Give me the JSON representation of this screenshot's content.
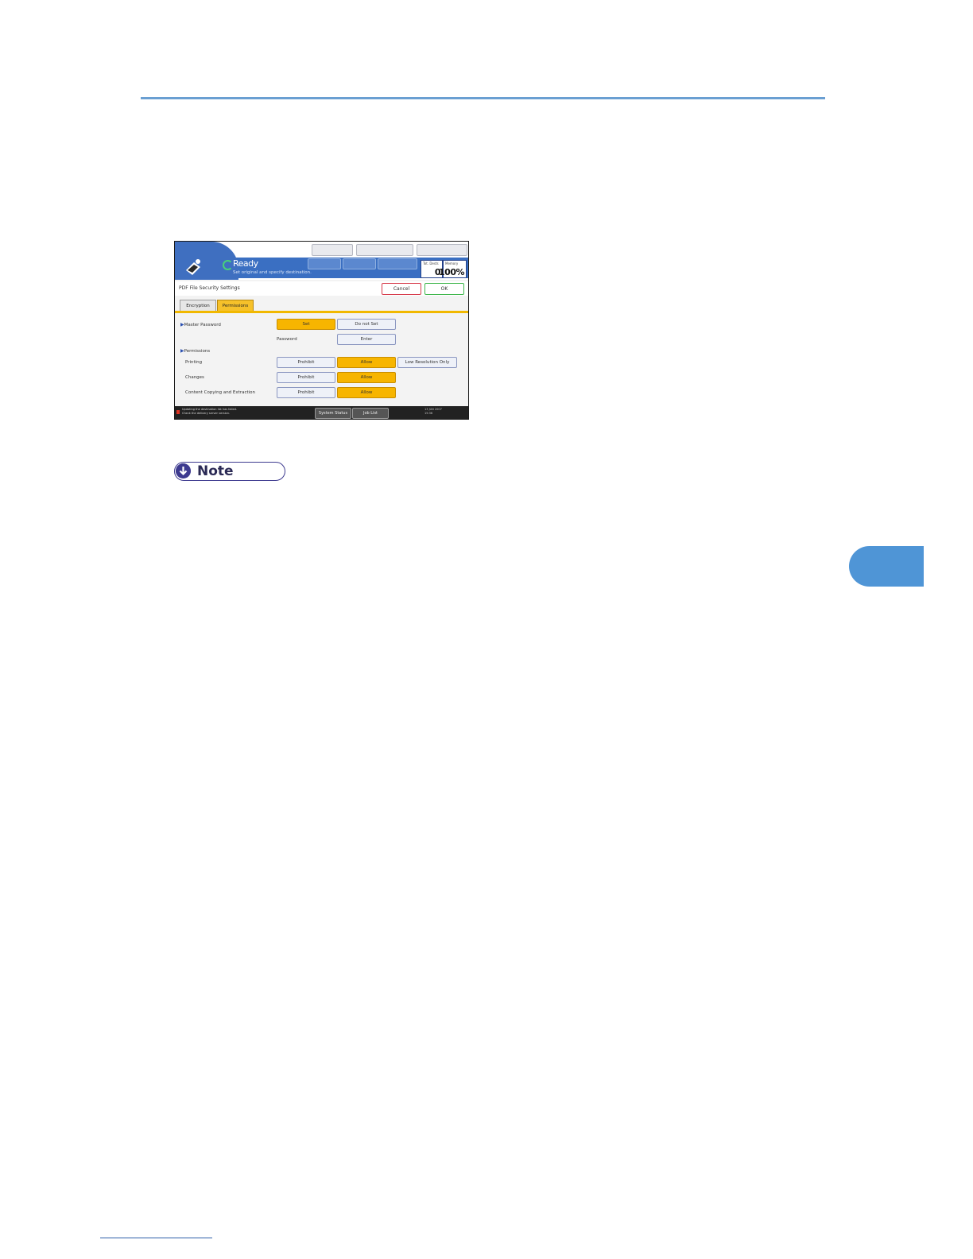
{
  "panel": {
    "header": {
      "status_title": "Ready",
      "status_message": "Set original and specify destination.",
      "counters": [
        {
          "label": "Tot. Dests",
          "value": "0"
        },
        {
          "label": "Memory",
          "value": "100%"
        }
      ]
    },
    "title_row": {
      "title": "PDF File Security Settings",
      "cancel": "Cancel",
      "ok": "OK"
    },
    "tabs": [
      "Encryption",
      "Permissions"
    ],
    "master_password": {
      "label": "Master Password",
      "options": [
        "Set",
        "Do not Set"
      ],
      "selected": "Set",
      "password_label": "Password",
      "enter": "Enter"
    },
    "permissions": {
      "label": "Permissions",
      "rows": [
        {
          "label": "Printing",
          "options": [
            "Prohibit",
            "Allow",
            "Low Resolution Only"
          ],
          "selected": "Allow"
        },
        {
          "label": "Changes",
          "options": [
            "Prohibit",
            "Allow"
          ],
          "selected": "Allow"
        },
        {
          "label": "Content Copying and Extraction",
          "options": [
            "Prohibit",
            "Allow"
          ],
          "selected": "Allow"
        }
      ]
    },
    "status_bar": {
      "message_line1": "Updating the destination list has failed.",
      "message_line2": "Check the delivery server version.",
      "system_status": "System Status",
      "job_list": "Job List",
      "date_line1": "13 JUN 2007",
      "date_line2": "15:36"
    }
  },
  "note": {
    "label": "Note"
  },
  "colors": {
    "accent": "#4f95d6",
    "header_blue": "#3a6fc2",
    "selected": "#f7b500",
    "note": "#3d3a8f"
  }
}
